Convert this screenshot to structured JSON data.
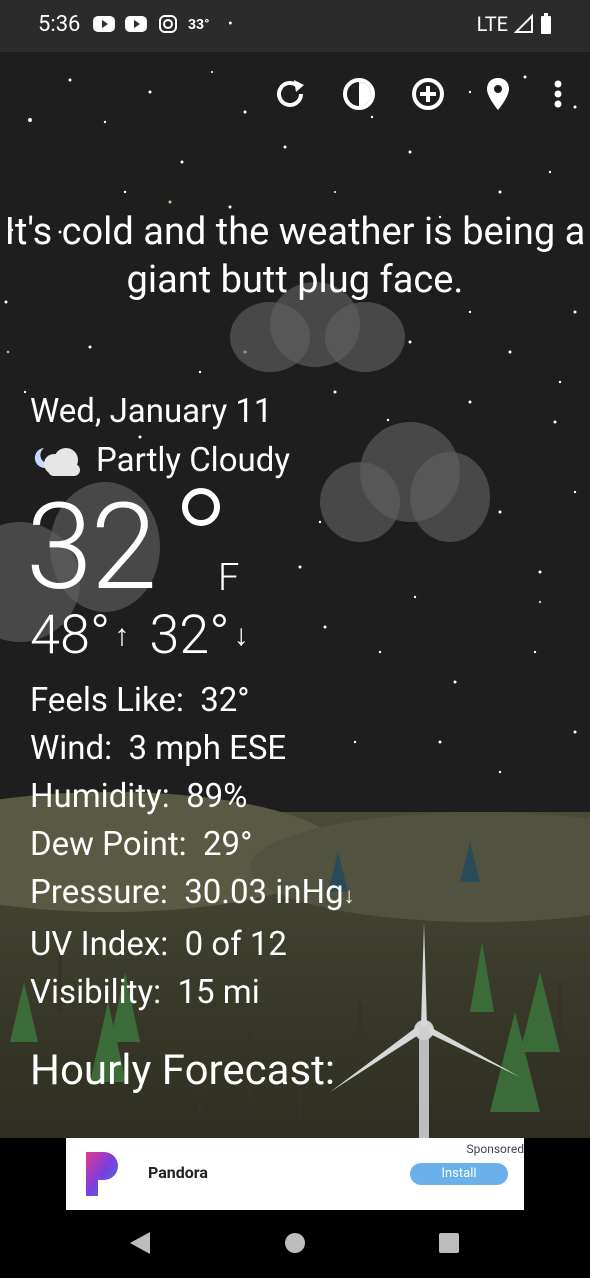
{
  "status_bar": {
    "time": "5:36",
    "temperature": "33°",
    "network": "LTE"
  },
  "message": "It's cold and the weather is being a giant butt plug face.",
  "weather": {
    "date": "Wed, January 11",
    "condition": "Partly Cloudy",
    "temperature": "32",
    "unit": "F",
    "high": "48°",
    "low": "32°",
    "details": [
      {
        "label": "Feels Like:",
        "value": "32°"
      },
      {
        "label": "Wind:",
        "value": "3 mph ESE"
      },
      {
        "label": "Humidity:",
        "value": "89%"
      },
      {
        "label": "Dew Point:",
        "value": "29°"
      },
      {
        "label": "Pressure:",
        "value": "30.03 inHg"
      },
      {
        "label": "UV Index:",
        "value": "0 of 12"
      },
      {
        "label": "Visibility:",
        "value": "15 mi"
      }
    ],
    "hourly_title": "Hourly Forecast:"
  },
  "ad": {
    "sponsored": "Sponsored",
    "app_name": "Pandora",
    "install": "Install"
  },
  "toolbar": [
    "refresh-icon",
    "theme-icon",
    "add-location-icon",
    "location-pin-icon",
    "more-icon"
  ]
}
